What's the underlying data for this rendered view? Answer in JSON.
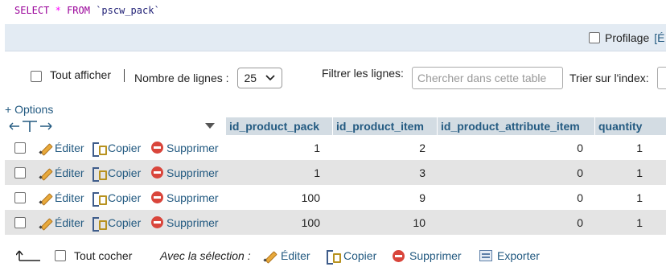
{
  "sql": {
    "select_kw": "SELECT",
    "star": "*",
    "from_kw": "FROM",
    "table": "`pscw_pack`"
  },
  "profiling": {
    "label": "Profilage",
    "link_fragment": "[É"
  },
  "nav": {
    "show_all_label": "Tout afficher",
    "rows_label": "Nombre de lignes :",
    "rows_value": "25",
    "filter_label": "Filtrer les lignes:",
    "filter_placeholder": "Chercher dans cette table",
    "sort_label": "Trier sur l'index:"
  },
  "options_label": "+ Options",
  "table": {
    "columns": [
      "id_product_pack",
      "id_product_item",
      "id_product_attribute_item",
      "quantity"
    ],
    "actions": {
      "edit": "Éditer",
      "copy": "Copier",
      "delete": "Supprimer"
    },
    "rows": [
      [
        "1",
        "2",
        "0",
        "1"
      ],
      [
        "1",
        "3",
        "0",
        "1"
      ],
      [
        "100",
        "9",
        "0",
        "1"
      ],
      [
        "100",
        "10",
        "0",
        "1"
      ]
    ]
  },
  "footer": {
    "check_all_label": "Tout cocher",
    "with_selection_label": "Avec la sélection :",
    "edit": "Éditer",
    "copy": "Copier",
    "delete": "Supprimer",
    "export": "Exporter"
  },
  "colors": {
    "link": "#235a81",
    "header_bg": "#d3dce3",
    "row_alt_bg": "#e4e4e4",
    "keyword": "#990099"
  }
}
